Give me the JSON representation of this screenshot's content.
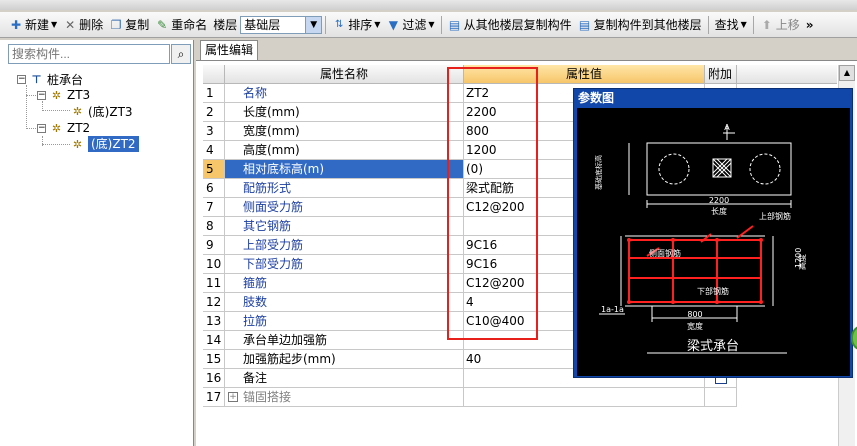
{
  "toolbar": {
    "new_label": "新建",
    "delete_label": "删除",
    "copy_label": "复制",
    "rename_label": "重命名",
    "floor_label": "楼层",
    "floor_value": "基础层",
    "sort_label": "排序",
    "filter_label": "过滤",
    "copy_from_floor_label": "从其他楼层复制构件",
    "copy_to_floor_label": "复制构件到其他楼层",
    "find_label": "查找",
    "up_label": "上移",
    "more_label": "»"
  },
  "search": {
    "placeholder": "搜索构件..."
  },
  "tree": {
    "root": "桩承台",
    "items": [
      {
        "label": "ZT3",
        "child": "(底)ZT3"
      },
      {
        "label": "ZT2",
        "child": "(底)ZT2"
      }
    ]
  },
  "tab": {
    "label": "属性编辑"
  },
  "grid": {
    "headers": {
      "name": "属性名称",
      "value": "属性值",
      "extra": "附加"
    },
    "rows": [
      {
        "num": "1",
        "name": "名称",
        "value": "ZT2",
        "color": "blue",
        "checkbox": false
      },
      {
        "num": "2",
        "name": "长度(mm)",
        "value": "2200",
        "color": "black",
        "checkbox": false
      },
      {
        "num": "3",
        "name": "宽度(mm)",
        "value": "800",
        "color": "black",
        "checkbox": false
      },
      {
        "num": "4",
        "name": "高度(mm)",
        "value": "1200",
        "color": "black",
        "checkbox": false
      },
      {
        "num": "5",
        "name": "相对底标高(m)",
        "value": "(0)",
        "color": "black",
        "checkbox": false,
        "selected": true
      },
      {
        "num": "6",
        "name": "配筋形式",
        "value": "梁式配筋",
        "color": "blue",
        "checkbox": false
      },
      {
        "num": "7",
        "name": "侧面受力筋",
        "value": "C12@200",
        "color": "blue",
        "checkbox": false
      },
      {
        "num": "8",
        "name": "其它钢筋",
        "value": "",
        "color": "blue",
        "checkbox": false
      },
      {
        "num": "9",
        "name": "上部受力筋",
        "value": "9C16",
        "color": "blue",
        "checkbox": false
      },
      {
        "num": "10",
        "name": "下部受力筋",
        "value": "9C16",
        "color": "blue",
        "checkbox": false
      },
      {
        "num": "11",
        "name": "箍筋",
        "value": "C12@200",
        "color": "blue",
        "checkbox": false
      },
      {
        "num": "12",
        "name": "肢数",
        "value": "4",
        "color": "blue",
        "checkbox": false
      },
      {
        "num": "13",
        "name": "拉筋",
        "value": "C10@400",
        "color": "blue",
        "checkbox": false
      },
      {
        "num": "14",
        "name": "承台单边加强筋",
        "value": "",
        "color": "black",
        "checkbox": false
      },
      {
        "num": "15",
        "name": "加强筋起步(mm)",
        "value": "40",
        "color": "black",
        "checkbox": false
      },
      {
        "num": "16",
        "name": "备注",
        "value": "",
        "color": "black",
        "checkbox": true
      },
      {
        "num": "17",
        "name": "锚固搭接",
        "value": "",
        "color": "grey",
        "checkbox": false,
        "expand": "+"
      }
    ]
  },
  "param_window": {
    "title": "参数图",
    "labels": {
      "top_mark": "A",
      "top_side": "基础底标高",
      "dim_length": "2200",
      "length_text": "长度",
      "top_rebar": "上部钢筋",
      "side_rebar": "侧面钢筋",
      "bottom_rebar": "下部钢筋",
      "dim_height": "1200",
      "height_text": "高度",
      "section": "1a-1a",
      "dim_width": "800",
      "width_text": "宽度",
      "caption": "梁式承台"
    }
  },
  "colors": {
    "highlight_frame": "#e8201c",
    "selection": "#316ac5",
    "header_value": "#f7c66a",
    "title_bar": "#1147a8"
  }
}
